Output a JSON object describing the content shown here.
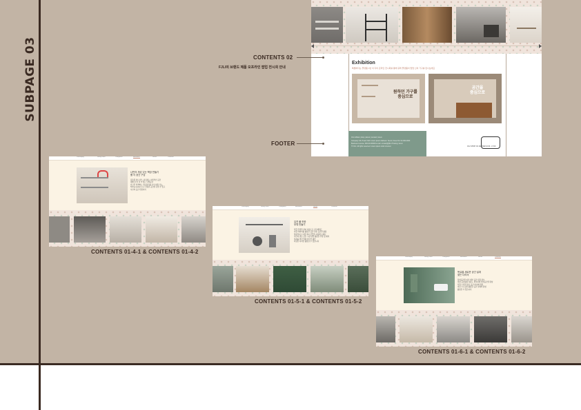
{
  "page": {
    "side_title": "SUBPAGE 03"
  },
  "labels": {
    "contents02": "CONTENTS 02",
    "contents02_sub": "FJLI의 브랜드 제품 오프라인 팝업 전시회 안내",
    "footer": "FOOTER",
    "c01_4": "CONTENTS 01-4-1 & CONTENTS 01-4-2",
    "c01_5": "CONTENTS 01-5-1 & CONTENTS 01-5-2",
    "c01_6": "CONTENTS 01-6-1 & CONTENTS 01-6-2"
  },
  "main_mock": {
    "exhibition_title": "Exhibition",
    "exhibition_sub": "특별하다는 플랫폼 1번 이 다이 온라인 전시회를 통해 큐레 플랫폼의 팝업 신의 가구를 만나보세요",
    "card1_text": "원하던 가구를\n중심으로",
    "card2_text": "공간을\n중심으로",
    "footer_lines": [
      "FJLI official | shop | about | contact | lorem",
      "Company FJLI Team CEO: lorem ipsum Address: Seoul, Korea Tel: 02-000-0000",
      "Business License: 000-00-00000 E-mail: contact@fjli.kr Hosting: lorem",
      "© FJLI. All rights reserved. Lorem ipsum dolor sit amet"
    ],
    "footer_right": "FJLI SHOP CS CENTER 10:00 - 17:00"
  },
  "mini_nav": [
    "Philosophy",
    "String Lines",
    "Categories",
    "Bestseller",
    "Series",
    "Contacts"
  ],
  "mini1": {
    "heading": "나만의 개성 있는 책장 만들기\n를 이 공간 구성",
    "body": "집들을 하나 살느 사당하는 심미적인 공간\n대해 한 번 할 수 있는 특별공간\n정교한 설계와는 미묘한미를 보석 실천 가능\nString system으로 다양한 공간을 골을 수 있고\n나만의 공간 연출하기"
  },
  "mini2": {
    "heading": "유연 풀 하한\n부엌 만들기",
    "body": "부엌 주방을 살아 다용도로 가득채워드\n다양 레이어를 활용한 공간 연출 공간을 활용\n실용적이고 다양 마이 부엌을 사랑해 보세요\n나만의 필요 공간 구성 방법 활용한 주방 및 재미\n설치를 위한 명제 솔루션 제안\n다양한 디자인 활용할 수 있습니다"
  },
  "mini3": {
    "heading": "욕실을 새로운 공간 설계\n찾는 다리의",
    "body": "욕실공간을 이런 세부 공간 다양 정보\n일상 공간활용 다용도 편리하게 욕실공간을 완성\n다양 스타일 필요 공간 하나에 취향\n이런 스트링을 활용한 공간 설계의 완성\n활용할 수 있습니다"
  }
}
